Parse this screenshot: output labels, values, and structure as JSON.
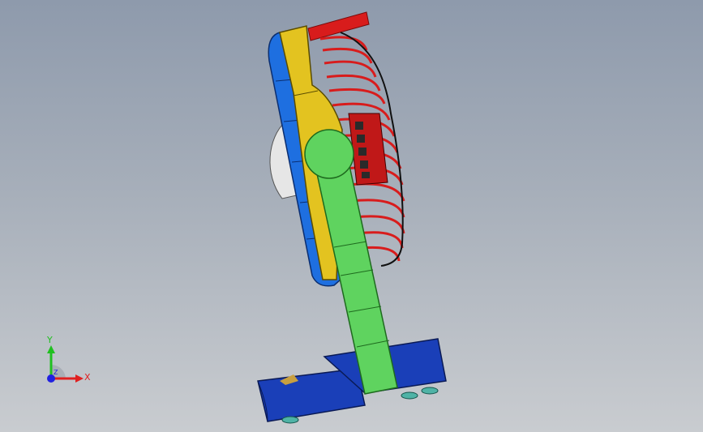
{
  "viewport": {
    "background_top": "#8e9aac",
    "background_bottom": "#c9ccd0"
  },
  "model": {
    "description_icon": "desk-fan-3d-model",
    "colors": {
      "front_grille_red": "#d81c1c",
      "fan_rim_blue": "#1e6fe0",
      "side_bracket_yellow": "#e3c320",
      "stand_arm_green": "#5fd35f",
      "base_blue": "#1a3fb8",
      "blade_grey": "#e6e6e6",
      "feet_teal": "#4fb3a6"
    }
  },
  "triad": {
    "x_label": "X",
    "y_label": "Y",
    "z_label": "Z",
    "x_color": "#e02020",
    "y_color": "#20c020",
    "z_color": "#2020e0"
  }
}
